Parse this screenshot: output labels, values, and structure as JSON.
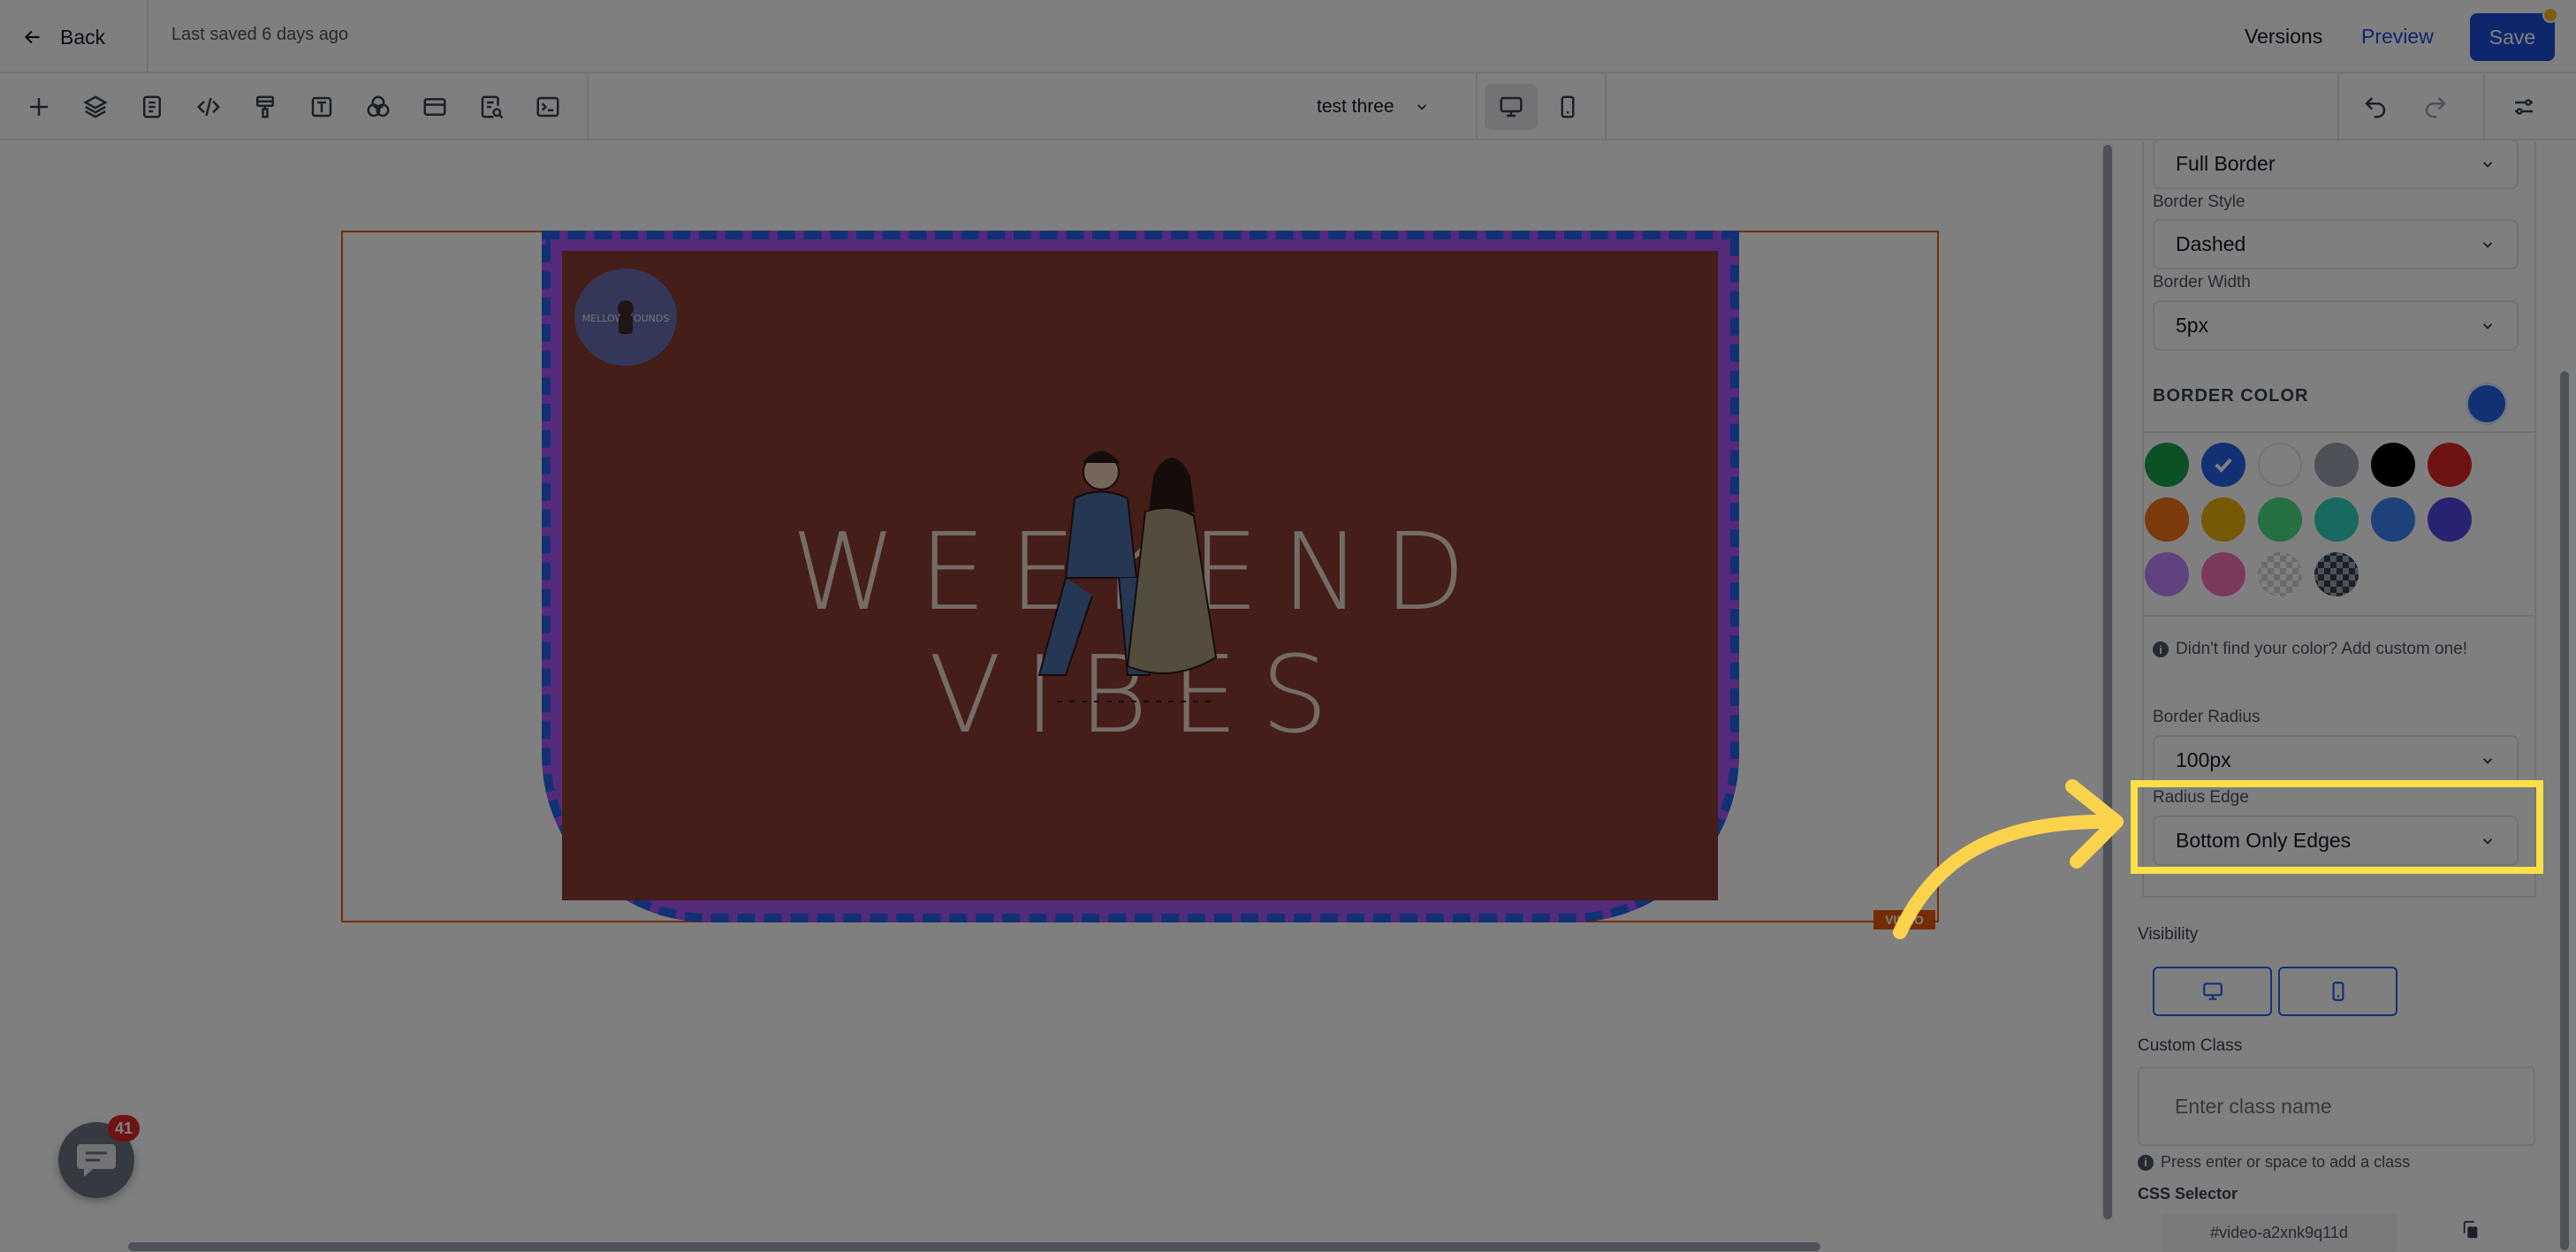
{
  "topbar": {
    "back_label": "Back",
    "last_saved": "Last saved 6 days ago",
    "versions_label": "Versions",
    "preview_label": "Preview",
    "save_label": "Save"
  },
  "toolbar": {
    "tools": [
      "add-icon",
      "layers-icon",
      "page-icon",
      "code-icon",
      "paint-roller-icon",
      "text-icon",
      "shapes-icon",
      "browser-icon",
      "search-doc-icon",
      "terminal-icon"
    ],
    "page_name": "test three",
    "devices": [
      "desktop",
      "mobile"
    ],
    "active_device": "desktop"
  },
  "canvas": {
    "video_tag": "VIDEO",
    "logo_text": "MELLOW SOUNDS",
    "title_text": "WEEKEND VIBES",
    "chat_badge_count": "41"
  },
  "panel": {
    "border_type": "Full Border",
    "border_style_label": "Border Style",
    "border_style_value": "Dashed",
    "border_width_label": "Border Width",
    "border_width_value": "5px",
    "border_color_title": "BORDER COLOR",
    "selected_color": "#2563eb",
    "swatches": [
      "#16a34a",
      "#2563eb",
      "#ffffff",
      "#9ca3af",
      "#000000",
      "#dc2626",
      "#f97316",
      "#eab308",
      "#4ade80",
      "#2dd4bf",
      "#3b82f6",
      "#4f46e5",
      "#c084fc",
      "#f472b6",
      "checkered-light",
      "checkered-dark"
    ],
    "color_hint": "Didn't find your color? Add custom one!",
    "border_radius_label": "Border Radius",
    "border_radius_value": "100px",
    "radius_edge_label": "Radius Edge",
    "radius_edge_value": "Bottom Only Edges",
    "visibility_label": "Visibility",
    "custom_class_label": "Custom Class",
    "custom_class_placeholder": "Enter class name",
    "custom_class_hint": "Press enter or space to add a class",
    "css_selector_label": "CSS Selector",
    "css_selector_value": "#video-a2xnk9q11d"
  },
  "colors": {
    "accent": "#1d4ed8",
    "highlight": "#fde047",
    "selection_outline": "#ea580c"
  }
}
